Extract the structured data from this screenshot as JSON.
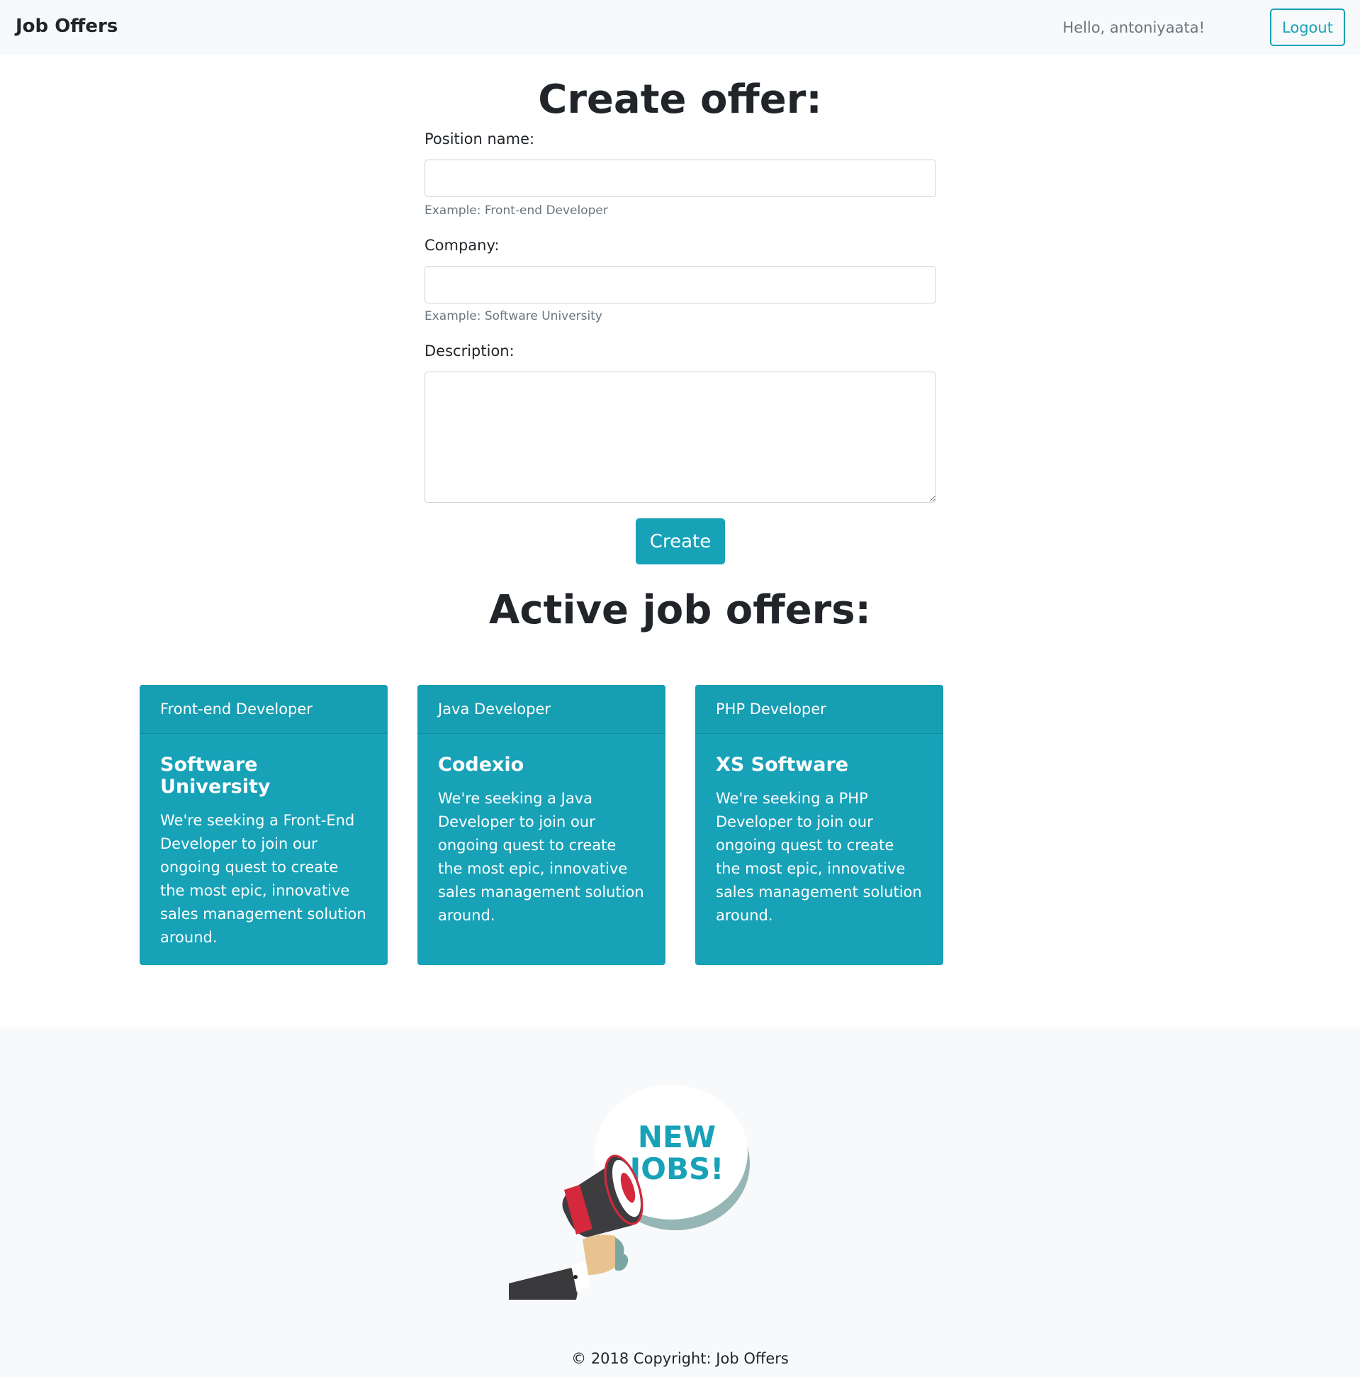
{
  "navbar": {
    "brand": "Job Offers",
    "greeting": "Hello, antoniyaata!",
    "logout_label": "Logout"
  },
  "form": {
    "title": "Create offer:",
    "position_label": "Position name:",
    "position_hint": "Example: Front-end Developer",
    "company_label": "Company:",
    "company_hint": "Example: Software University",
    "description_label": "Description:",
    "create_label": "Create"
  },
  "offers": {
    "title": "Active job offers:",
    "items": [
      {
        "position": "Front-end Developer",
        "company": "Software University",
        "description": "We're seeking a Front-End Developer to join our ongoing quest to create the most epic, innovative sales management solution around."
      },
      {
        "position": "Java Developer",
        "company": "Codexio",
        "description": "We're seeking a Java Developer to join our ongoing quest to create the most epic, innovative sales management solution around."
      },
      {
        "position": "PHP Developer",
        "company": "XS Software",
        "description": "We're seeking a PHP Developer to join our ongoing quest to create the most epic, innovative sales management solution around."
      }
    ]
  },
  "footer": {
    "illustration_text": "NEW JOBS!",
    "copyright": "© 2018 Copyright: Job Offers"
  },
  "colors": {
    "accent": "#17a2b8",
    "navbar_bg": "#f8f9fa",
    "text": "#212529",
    "muted": "#6c757d"
  },
  "icons": {
    "illustration": "megaphone-icon"
  }
}
